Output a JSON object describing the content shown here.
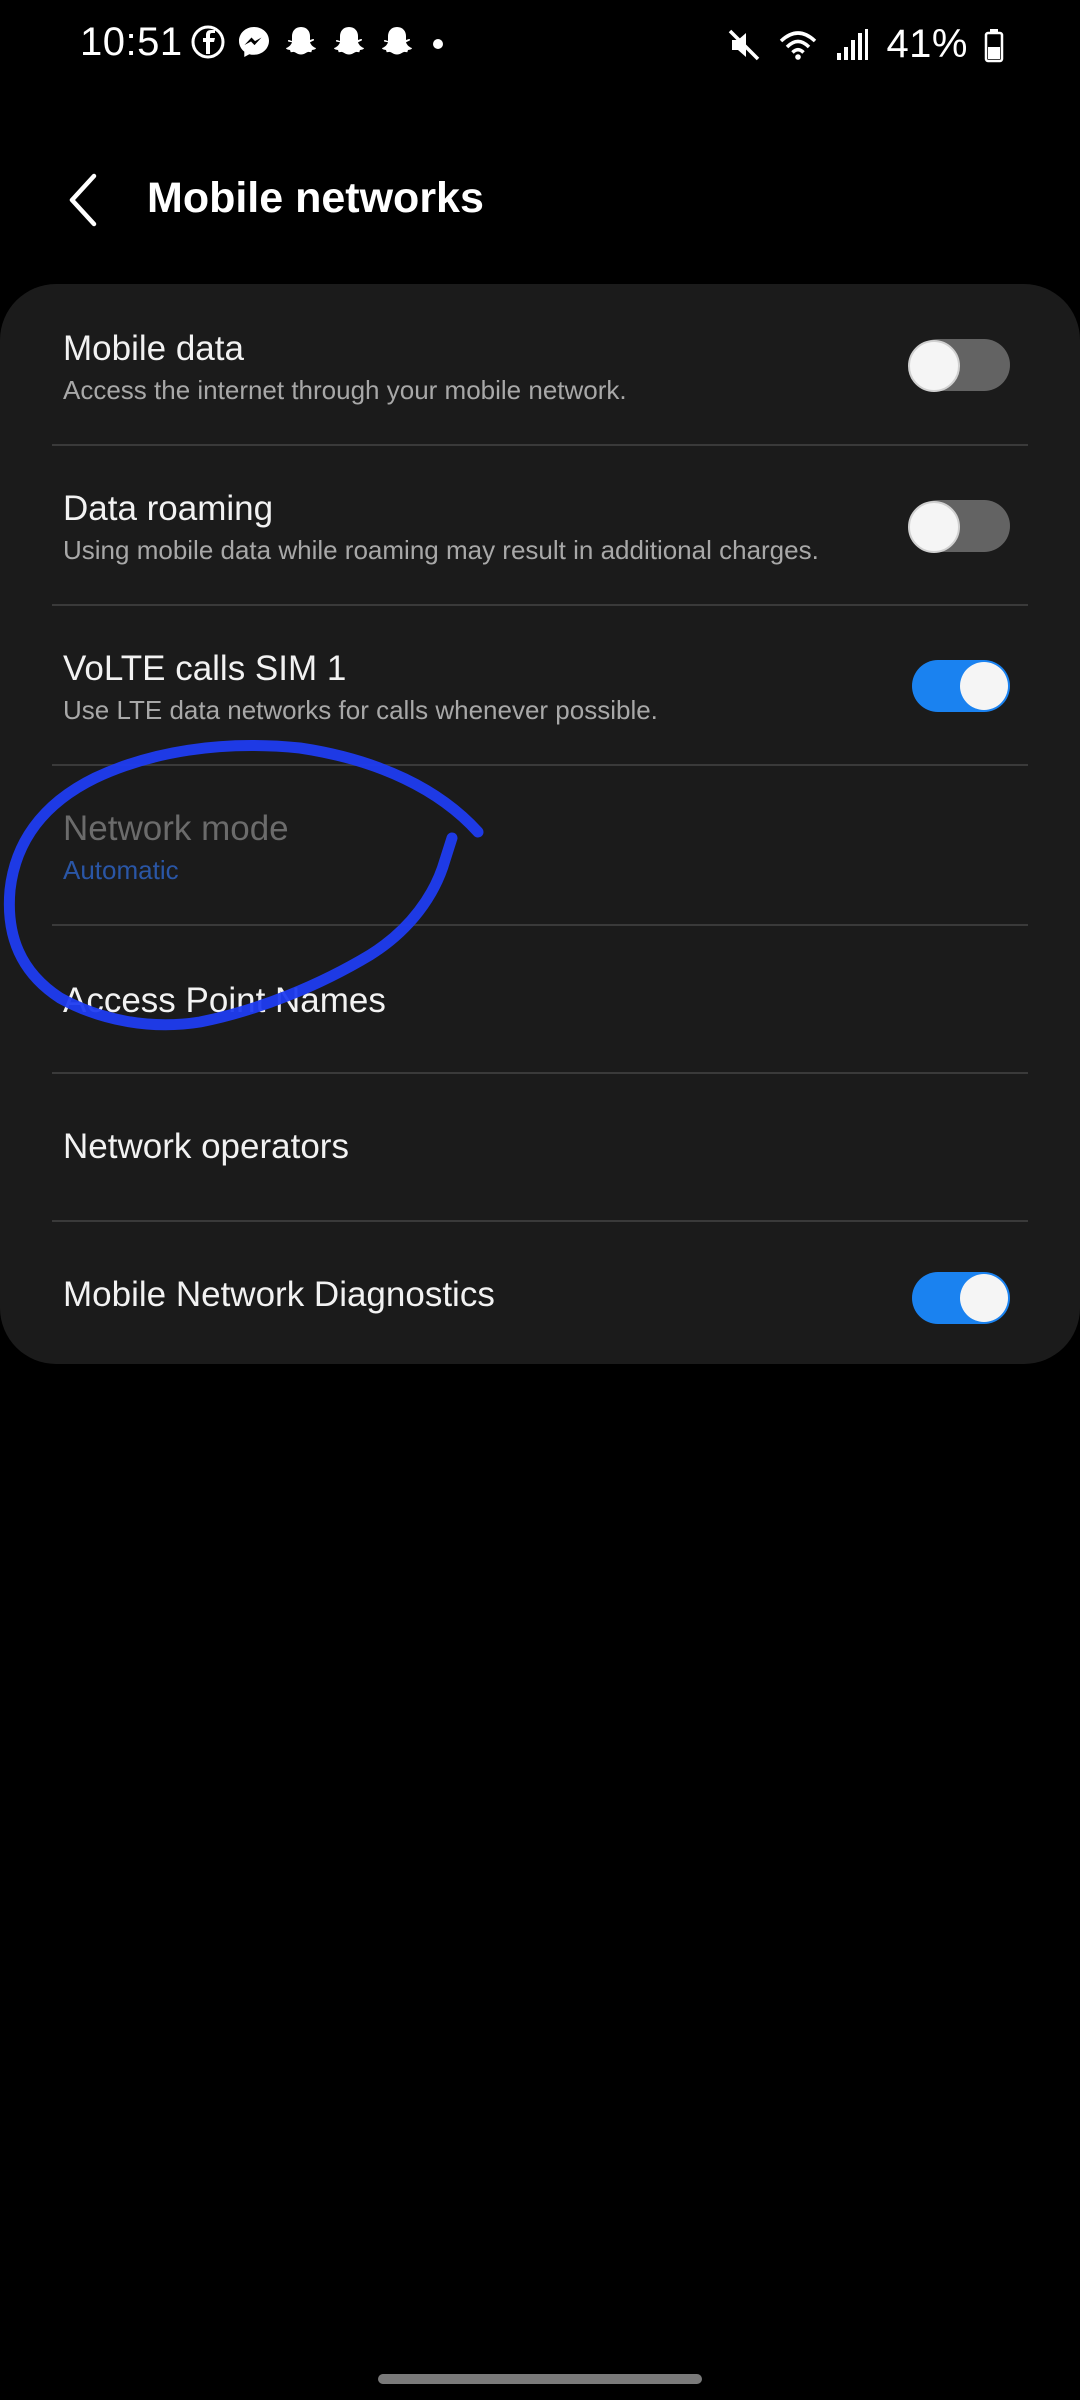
{
  "status_bar": {
    "time": "10:51",
    "notification_icons": [
      "facebook-icon",
      "messenger-icon",
      "snapchat-icon",
      "snapchat-icon",
      "snapchat-icon",
      "dot-icon"
    ],
    "right_icons": [
      "mute-icon",
      "wifi-icon",
      "signal-icon"
    ],
    "battery_percent": "41%"
  },
  "header": {
    "title": "Mobile networks"
  },
  "settings": [
    {
      "title": "Mobile data",
      "subtitle": "Access the internet through your mobile network.",
      "toggle": "off"
    },
    {
      "title": "Data roaming",
      "subtitle": "Using mobile data while roaming may result in additional charges.",
      "toggle": "off"
    },
    {
      "title": "VoLTE calls SIM 1",
      "subtitle": "Use LTE data networks for calls whenever possible.",
      "toggle": "on"
    },
    {
      "title": "Network mode",
      "subtitle": "Automatic",
      "disabled": true
    },
    {
      "title": "Access Point Names"
    },
    {
      "title": "Network operators"
    },
    {
      "title": "Mobile Network Diagnostics",
      "toggle": "on"
    }
  ],
  "colors": {
    "background": "#000000",
    "card": "#1b1b1b",
    "toggle_on": "#1a82f0",
    "toggle_off": "#636363",
    "accent_text": "#2a56a6",
    "annotation": "#1f3cf0"
  }
}
